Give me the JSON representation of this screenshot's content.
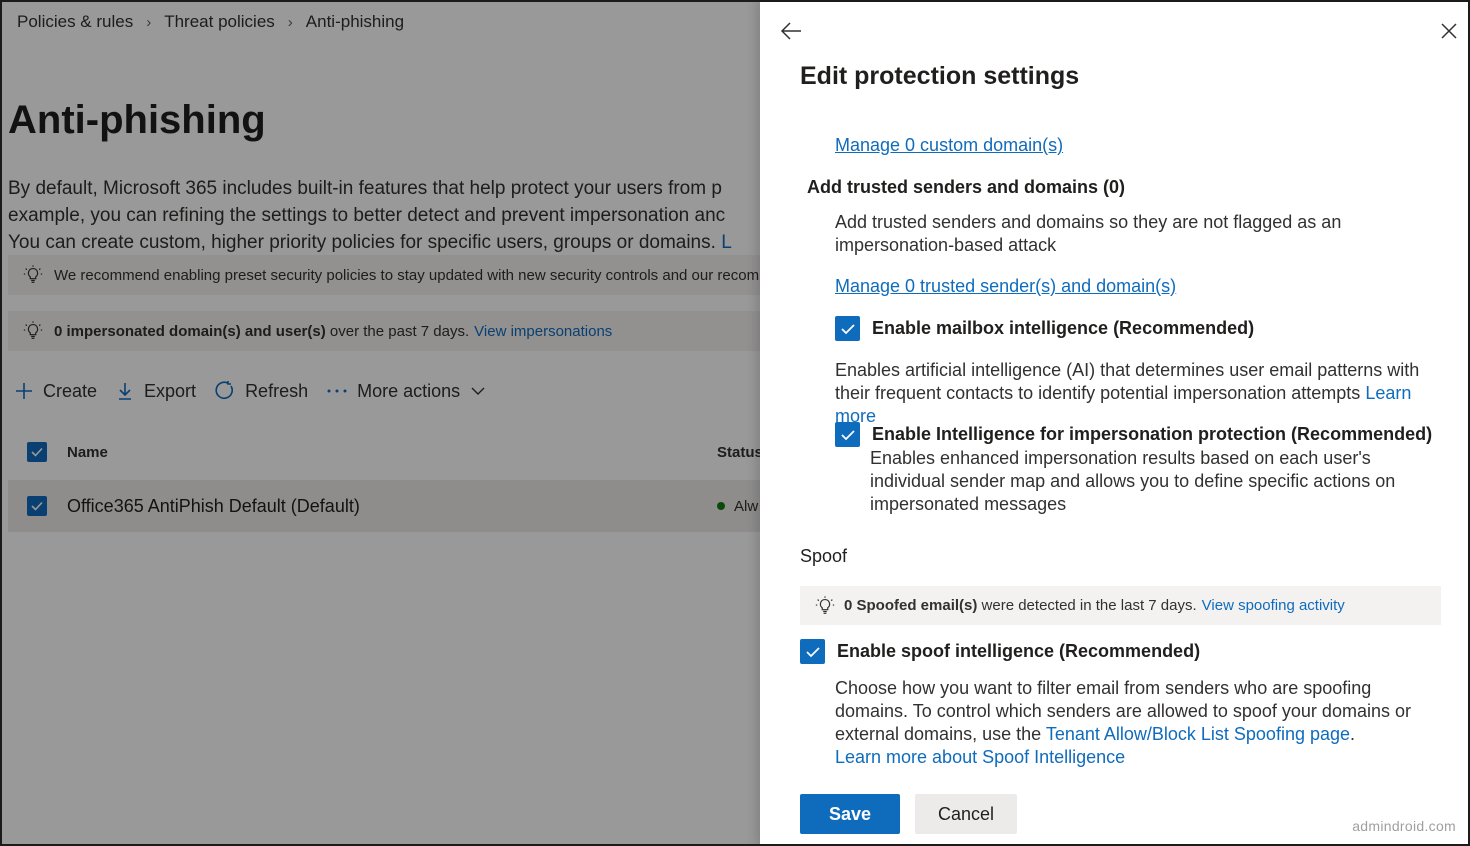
{
  "breadcrumb": [
    "Policies & rules",
    "Threat policies",
    "Anti-phishing"
  ],
  "page": {
    "title": "Anti-phishing",
    "desc_line1": "By default, Microsoft 365 includes built-in features that help protect your users from p",
    "desc_line2": "example, you can refining the settings to better detect and prevent impersonation anc",
    "desc_line3": "You can create custom, higher priority policies for specific users, groups or domains.",
    "desc_line3_link": "L",
    "recommend_text": "We recommend enabling preset security policies to stay updated with new security controls and our recomm",
    "impersonated_bold": "0 impersonated domain(s) and user(s)",
    "impersonated_rest": "over the past 7 days.",
    "impersonated_link": "View impersonations"
  },
  "toolbar": {
    "create": "Create",
    "export": "Export",
    "refresh": "Refresh",
    "more_actions": "More actions"
  },
  "table": {
    "col_name": "Name",
    "col_status": "Status",
    "rows": [
      {
        "name": "Office365 AntiPhish Default (Default)",
        "status": "Alw"
      }
    ]
  },
  "panel": {
    "title": "Edit protection settings",
    "manage_custom_domains": "Manage 0 custom domain(s)",
    "trusted_heading": "Add trusted senders and domains (0)",
    "trusted_desc": "Add trusted senders and domains so they are not flagged as an impersonation-based attack",
    "manage_trusted": "Manage 0 trusted sender(s) and domain(s)",
    "mailbox_intel_label": "Enable mailbox intelligence (Recommended)",
    "mailbox_intel_desc": "Enables artificial intelligence (AI) that determines user email patterns with their frequent contacts to identify potential impersonation attempts",
    "mailbox_intel_link": "Learn more",
    "imp_protection_label": "Enable Intelligence for impersonation protection (Recommended)",
    "imp_protection_desc": "Enables enhanced impersonation results based on each user's individual sender map and allows you to define specific actions on impersonated messages",
    "spoof_heading": "Spoof",
    "spoof_bar_bold": "0 Spoofed email(s)",
    "spoof_bar_rest": "were detected in the last 7 days.",
    "spoof_bar_link": "View spoofing activity",
    "spoof_intel_label": "Enable spoof intelligence (Recommended)",
    "spoof_desc": "Choose how you want to filter email from senders who are spoofing domains. To control which senders are allowed to spoof your domains or external domains, use the",
    "spoof_desc_link": "Tenant Allow/Block List Spoofing page",
    "spoof_desc_end": ".",
    "spoof_learn_more": "Learn more about Spoof Intelligence",
    "save": "Save",
    "cancel": "Cancel",
    "mailbox_intel_checked": true,
    "imp_protection_checked": true,
    "spoof_intel_checked": true
  },
  "watermark": "admindroid.com",
  "colors": {
    "accent": "#0f6cbd",
    "status_green": "#107c10"
  }
}
